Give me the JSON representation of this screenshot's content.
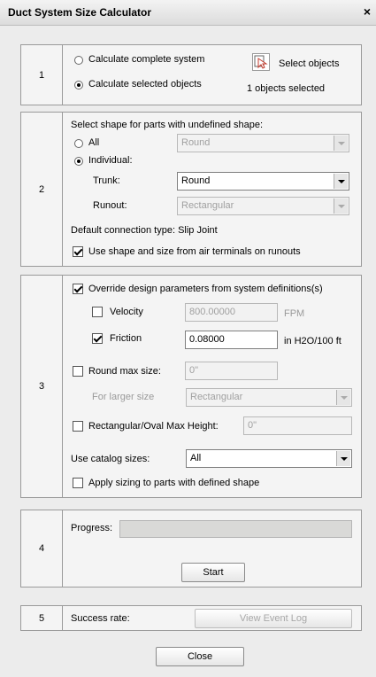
{
  "window": {
    "title": "Duct System Size Calculator",
    "close_glyph": "×"
  },
  "section1": {
    "number": "1",
    "opt_complete": "Calculate complete system",
    "opt_selected": "Calculate selected objects",
    "select_objects_label": "Select objects",
    "objects_selected": "1 objects selected"
  },
  "section2": {
    "number": "2",
    "heading": "Select shape for parts with undefined shape:",
    "all_label": "All",
    "all_value": "Round",
    "individual_label": "Individual:",
    "trunk_label": "Trunk:",
    "trunk_value": "Round",
    "runout_label": "Runout:",
    "runout_value": "Rectangular",
    "connection_text": "Default connection type: Slip Joint",
    "use_shape_label": "Use shape and size from air terminals on runouts"
  },
  "section3": {
    "number": "3",
    "override_label": "Override design parameters from system definitions(s)",
    "velocity_label": "Velocity",
    "velocity_value": "800.00000",
    "velocity_unit": "FPM",
    "friction_label": "Friction",
    "friction_value": "0.08000",
    "friction_unit": "in H2O/100 ft",
    "round_max_label": "Round max size:",
    "round_max_value": "0\"",
    "larger_size_label": "For larger size",
    "larger_size_value": "Rectangular",
    "rect_max_label": "Rectangular/Oval Max Height:",
    "rect_max_value": "0\"",
    "catalog_label": "Use catalog sizes:",
    "catalog_value": "All",
    "apply_sizing_label": "Apply sizing to parts with defined shape"
  },
  "section4": {
    "number": "4",
    "progress_label": "Progress:",
    "progress_fraction": 0,
    "start_label": "Start"
  },
  "section5": {
    "number": "5",
    "success_label": "Success rate:",
    "view_log_label": "View Event Log"
  },
  "footer": {
    "close_label": "Close"
  },
  "icons": {
    "select_objects": "cursor-select-icon"
  }
}
